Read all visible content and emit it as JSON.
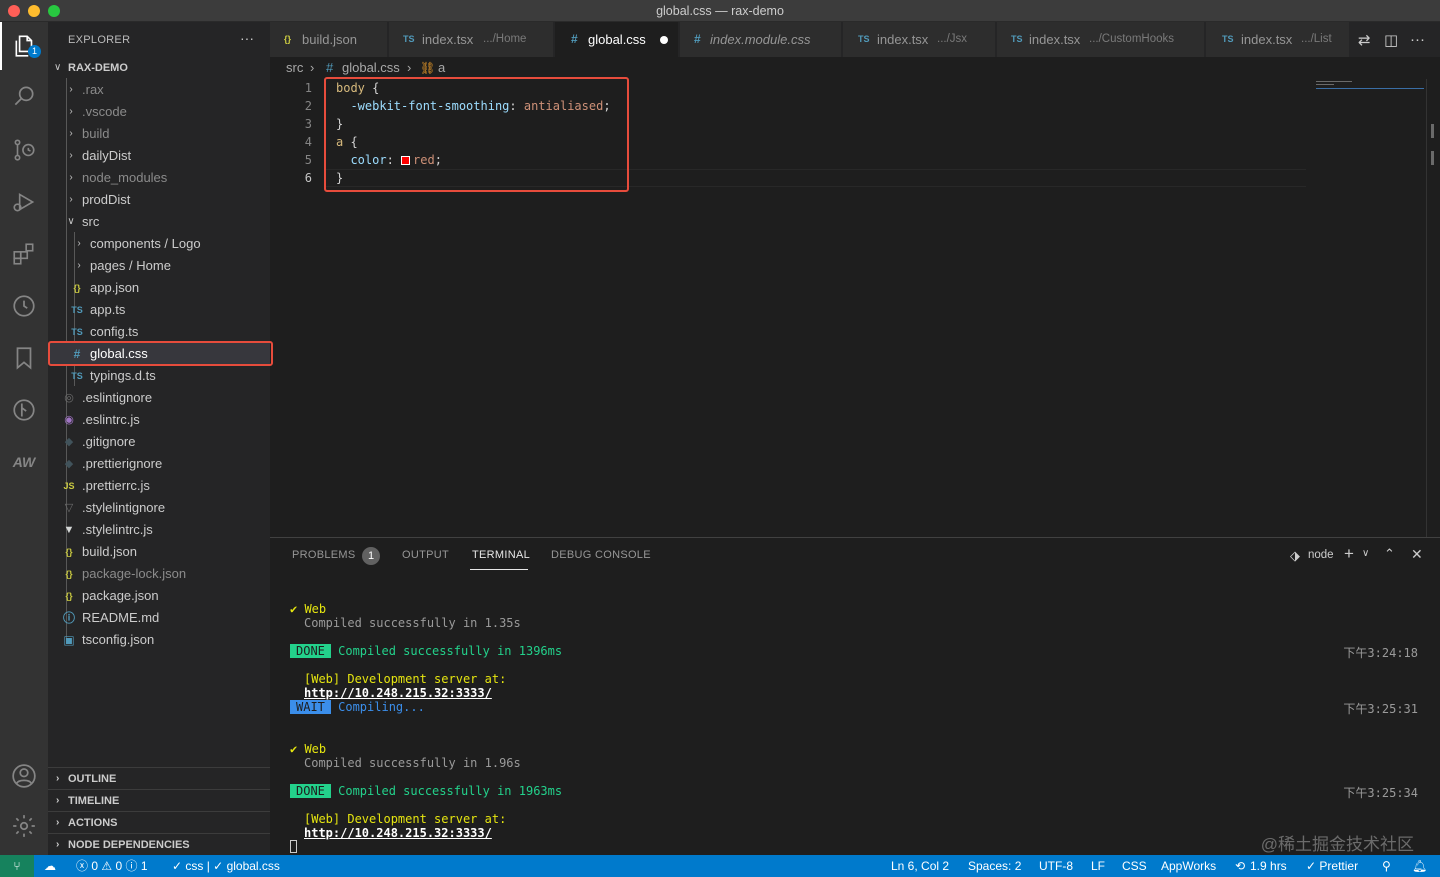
{
  "window": {
    "title": "global.css — rax-demo"
  },
  "explorer": {
    "header": "EXPLORER",
    "more": "···",
    "root": "RAX-DEMO",
    "items": [
      {
        "label": ".rax",
        "kind": "folder"
      },
      {
        "label": ".vscode",
        "kind": "folder"
      },
      {
        "label": "build",
        "kind": "folder"
      },
      {
        "label": "dailyDist",
        "kind": "folder"
      },
      {
        "label": "node_modules",
        "kind": "folder"
      },
      {
        "label": "prodDist",
        "kind": "folder"
      },
      {
        "label": "src",
        "kind": "folder-open"
      },
      {
        "label": "components / Logo",
        "kind": "folder"
      },
      {
        "label": "pages / Home",
        "kind": "folder"
      },
      {
        "label": "app.json",
        "kind": "json",
        "icon": "{}"
      },
      {
        "label": "app.ts",
        "kind": "ts",
        "icon": "TS"
      },
      {
        "label": "config.ts",
        "kind": "ts",
        "icon": "TS"
      },
      {
        "label": "global.css",
        "kind": "css",
        "icon": "#"
      },
      {
        "label": "typings.d.ts",
        "kind": "ts",
        "icon": "TS"
      },
      {
        "label": ".eslintignore",
        "kind": "eslint",
        "icon": "◎"
      },
      {
        "label": ".eslintrc.js",
        "kind": "eslint",
        "icon": "◉"
      },
      {
        "label": ".gitignore",
        "kind": "git",
        "icon": "◆"
      },
      {
        "label": ".prettierignore",
        "kind": "prettier",
        "icon": "◆"
      },
      {
        "label": ".prettierrc.js",
        "kind": "js",
        "icon": "JS"
      },
      {
        "label": ".stylelintignore",
        "kind": "stylelint",
        "icon": "▽"
      },
      {
        "label": ".stylelintrc.js",
        "kind": "stylelint",
        "icon": "▼"
      },
      {
        "label": "build.json",
        "kind": "json",
        "icon": "{}"
      },
      {
        "label": "package-lock.json",
        "kind": "json",
        "icon": "{}"
      },
      {
        "label": "package.json",
        "kind": "json",
        "icon": "{}"
      },
      {
        "label": "README.md",
        "kind": "info",
        "icon": "ⓘ"
      },
      {
        "label": "tsconfig.json",
        "kind": "tsconfig",
        "icon": "▣"
      }
    ],
    "sections": [
      "OUTLINE",
      "TIMELINE",
      "ACTIONS",
      "NODE DEPENDENCIES"
    ]
  },
  "tabs": [
    {
      "icon": "{}",
      "label": "build.json",
      "desc": ""
    },
    {
      "icon": "TS",
      "label": "index.tsx",
      "desc": ".../Home"
    },
    {
      "icon": "#",
      "label": "global.css",
      "desc": "",
      "active": true
    },
    {
      "icon": "#",
      "label": "index.module.css",
      "desc": ""
    },
    {
      "icon": "TS",
      "label": "index.tsx",
      "desc": ".../Jsx"
    },
    {
      "icon": "TS",
      "label": "index.tsx",
      "desc": ".../CustomHooks"
    },
    {
      "icon": "TS",
      "label": "index.tsx",
      "desc": ".../List"
    }
  ],
  "breadcrumb": {
    "src": "src",
    "file": "global.css",
    "symbol": "a"
  },
  "editor": {
    "lines": [
      {
        "n": "1"
      },
      {
        "n": "2"
      },
      {
        "n": "3"
      },
      {
        "n": "4"
      },
      {
        "n": "5"
      },
      {
        "n": "6"
      }
    ],
    "code": {
      "l1_sel": "body",
      "l1_rest": " {",
      "l2_prop": "  -webkit-font-smoothing",
      "l2_colon": ": ",
      "l2_val": "antialiased",
      "l2_end": ";",
      "l3": "}",
      "l4_sel": "a",
      "l4_rest": " {",
      "l5_prop": "  color",
      "l5_colon": ": ",
      "l5_val": "red",
      "l5_end": ";",
      "l6": "}"
    }
  },
  "panel": {
    "tabs": {
      "problems": "PROBLEMS",
      "problems_count": "1",
      "output": "OUTPUT",
      "terminal": "TERMINAL",
      "debug": "DEBUG CONSOLE"
    },
    "shell": "node",
    "terminal": {
      "web1": "Web",
      "compiled1": "Compiled successfully in 1.35s",
      "done1": "DONE",
      "done1_msg": " Compiled successfully in 1396ms",
      "time1": "下午3:24:18",
      "server1": "[Web] Development server at:",
      "url1": "http://10.248.215.32:3333/",
      "wait": "WAIT",
      "wait_msg": " Compiling...",
      "time2": "下午3:25:31",
      "web2": "Web",
      "compiled2": "Compiled successfully in 1.96s",
      "done2": "DONE",
      "done2_msg": " Compiled successfully in 1963ms",
      "time3": "下午3:25:34",
      "server2": "[Web] Development server at:",
      "url2": "http://10.248.215.32:3333/"
    },
    "watermark": "@稀土掘金技术社区"
  },
  "statusbar": {
    "errors": "0",
    "warnings": "0",
    "infos": "1",
    "css_check": "✓ css | ✓ global.css",
    "position": "Ln 6, Col 2",
    "spaces": "Spaces: 2",
    "encoding": "UTF-8",
    "eol": "LF",
    "language": "CSS",
    "appworks": "AppWorks",
    "time": "1.9 hrs",
    "prettier": "✓ Prettier"
  },
  "colors": {
    "accent": "#007acc",
    "highlight_box": "#e74c3c",
    "red_swatch": "#ff0000"
  }
}
